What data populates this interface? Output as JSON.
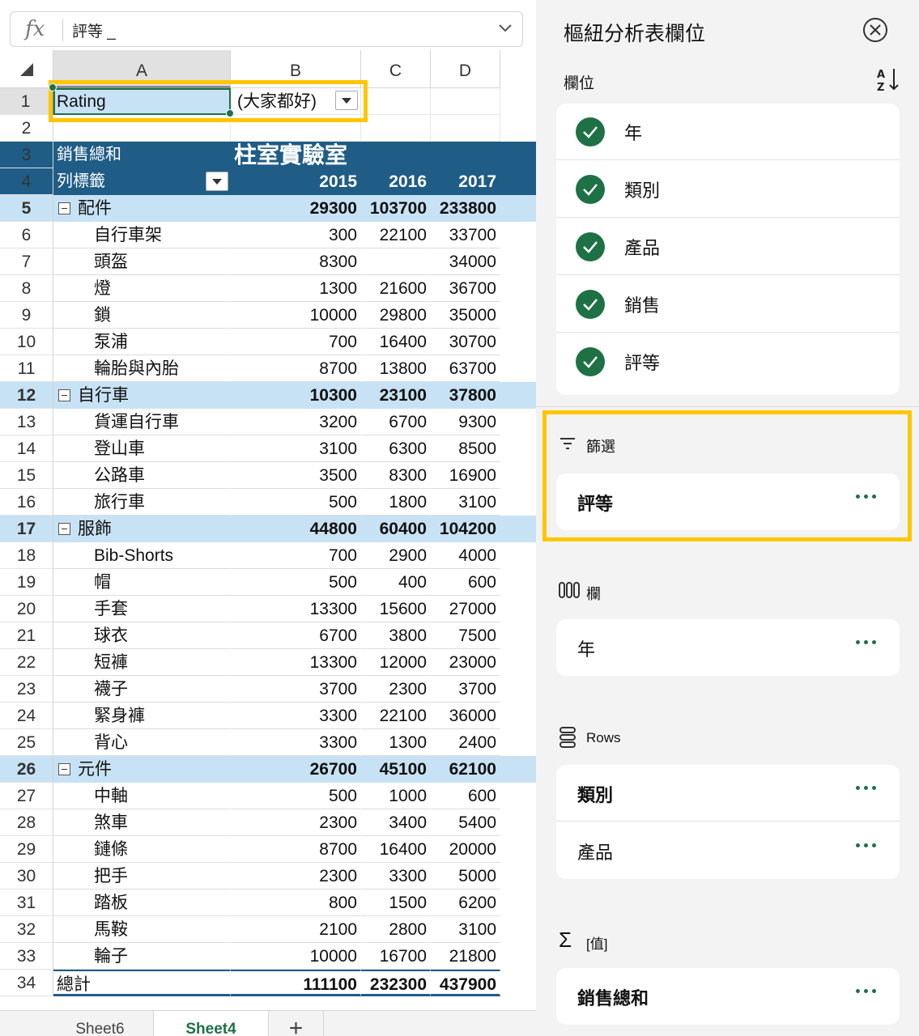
{
  "formula_bar": {
    "fx": "fx",
    "value": "評等 _"
  },
  "columns": [
    "A",
    "B",
    "C",
    "D"
  ],
  "rows_numbers": [
    "1",
    "2",
    "3",
    "4",
    "5",
    "6",
    "7",
    "8",
    "9",
    "10",
    "11",
    "12",
    "13",
    "14",
    "15",
    "16",
    "17",
    "18",
    "19",
    "20",
    "21",
    "22",
    "23",
    "24",
    "25",
    "26",
    "27",
    "28",
    "29",
    "30",
    "31",
    "32",
    "33",
    "34"
  ],
  "filter_row": {
    "label": "Rating",
    "value": "(大家都好)"
  },
  "pivot": {
    "values_caption": "銷售總和",
    "title": "柱室實驗室",
    "row_labels_caption": "列標籤",
    "years": [
      "2015",
      "2016",
      "2017"
    ],
    "groups": [
      {
        "name": "配件",
        "totals": [
          "29300",
          "103700",
          "233800"
        ],
        "items": [
          {
            "name": "自行車架",
            "v": [
              "300",
              "22100",
              "33700"
            ]
          },
          {
            "name": "頭盔",
            "v": [
              "8300",
              "",
              "34000"
            ]
          },
          {
            "name": "燈",
            "v": [
              "1300",
              "21600",
              "36700"
            ]
          },
          {
            "name": "鎖",
            "v": [
              "10000",
              "29800",
              "35000"
            ]
          },
          {
            "name": "泵浦",
            "v": [
              "700",
              "16400",
              "30700"
            ]
          },
          {
            "name": "輪胎與內胎",
            "v": [
              "8700",
              "13800",
              "63700"
            ]
          }
        ]
      },
      {
        "name": "自行車",
        "totals": [
          "10300",
          "23100",
          "37800"
        ],
        "items": [
          {
            "name": "貨運自行車",
            "v": [
              "3200",
              "6700",
              "9300"
            ]
          },
          {
            "name": "登山車",
            "v": [
              "3100",
              "6300",
              "8500"
            ]
          },
          {
            "name": "公路車",
            "v": [
              "3500",
              "8300",
              "16900"
            ]
          },
          {
            "name": "旅行車",
            "v": [
              "500",
              "1800",
              "3100"
            ]
          }
        ]
      },
      {
        "name": "服飾",
        "totals": [
          "44800",
          "60400",
          "104200"
        ],
        "items": [
          {
            "name": "Bib-Shorts",
            "v": [
              "700",
              "2900",
              "4000"
            ]
          },
          {
            "name": "帽",
            "v": [
              "500",
              "400",
              "600"
            ]
          },
          {
            "name": "手套",
            "v": [
              "13300",
              "15600",
              "27000"
            ]
          },
          {
            "name": "球衣",
            "v": [
              "6700",
              "3800",
              "7500"
            ]
          },
          {
            "name": "短褲",
            "v": [
              "13300",
              "12000",
              "23000"
            ]
          },
          {
            "name": "襪子",
            "v": [
              "3700",
              "2300",
              "3700"
            ]
          },
          {
            "name": "緊身褲",
            "v": [
              "3300",
              "22100",
              "36000"
            ]
          },
          {
            "name": "背心",
            "v": [
              "3300",
              "1300",
              "2400"
            ]
          }
        ]
      },
      {
        "name": "元件",
        "totals": [
          "26700",
          "45100",
          "62100"
        ],
        "items": [
          {
            "name": "中軸",
            "v": [
              "500",
              "1000",
              "600"
            ]
          },
          {
            "name": "煞車",
            "v": [
              "2300",
              "3400",
              "5400"
            ]
          },
          {
            "name": "鏈條",
            "v": [
              "8700",
              "16400",
              "20000"
            ]
          },
          {
            "name": "把手",
            "v": [
              "2300",
              "3300",
              "5000"
            ]
          },
          {
            "name": "踏板",
            "v": [
              "800",
              "1500",
              "6200"
            ]
          },
          {
            "name": "馬鞍",
            "v": [
              "2100",
              "2800",
              "3100"
            ]
          },
          {
            "name": "輪子",
            "v": [
              "10000",
              "16700",
              "21800"
            ]
          }
        ]
      }
    ],
    "grand_total": {
      "label": "總計",
      "v": [
        "111100",
        "232300",
        "437900"
      ]
    }
  },
  "sheet_tabs": [
    {
      "name": "Sheet6",
      "active": false
    },
    {
      "name": "Sheet4",
      "active": true
    }
  ],
  "add_sheet": "+",
  "pane": {
    "title": "樞紐分析表欄位",
    "fields_label": "欄位",
    "fields": [
      "年",
      "類別",
      "產品",
      "銷售",
      "評等"
    ],
    "filters_label": "篩選",
    "filters": [
      "評等"
    ],
    "columns_label": "欄",
    "columns": [
      "年"
    ],
    "rows_label": "Rows",
    "rows": [
      "類別",
      "產品"
    ],
    "values_label": "[值]",
    "values": [
      "銷售總和"
    ]
  },
  "colors": {
    "accent_green": "#1e7145",
    "pivot_header": "#1f5c86",
    "pivot_band": "#c7e2f4",
    "highlight": "#ffc600"
  }
}
